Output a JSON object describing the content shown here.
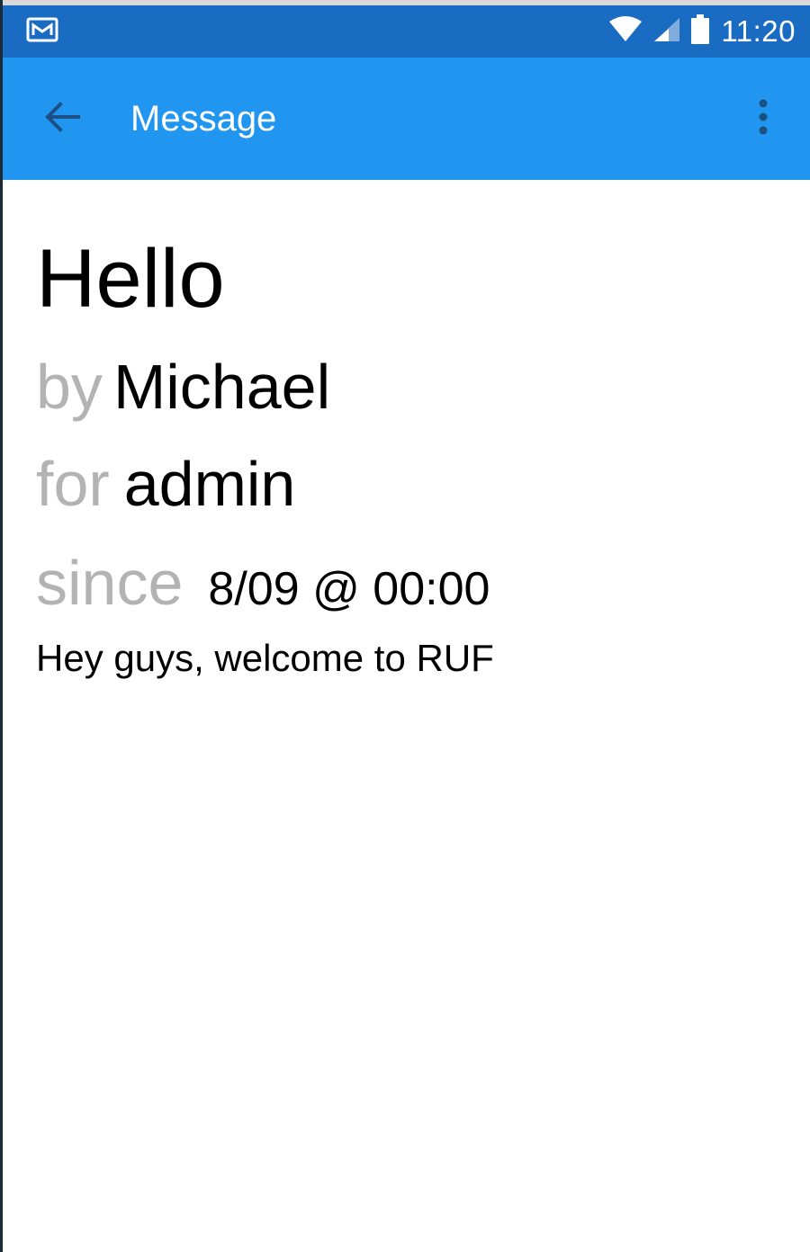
{
  "status_bar": {
    "notification_icon": "gmail-notification-icon",
    "time": "11:20",
    "icons": [
      "wifi-icon",
      "cellular-signal-icon",
      "battery-icon"
    ],
    "color": "#1a6bc2"
  },
  "app_bar": {
    "title": "Message",
    "back_icon": "arrow-back-icon",
    "overflow_icon": "more-vert-icon",
    "color": "#2196f0"
  },
  "message": {
    "title": "Hello",
    "by_label": "by",
    "author": "Michael",
    "for_label": "for",
    "recipient": "admin",
    "since_label": "since",
    "date": "8/09 @ 00:00",
    "body": "Hey guys, welcome to RUF",
    "label_color": "#b3b3b3"
  }
}
